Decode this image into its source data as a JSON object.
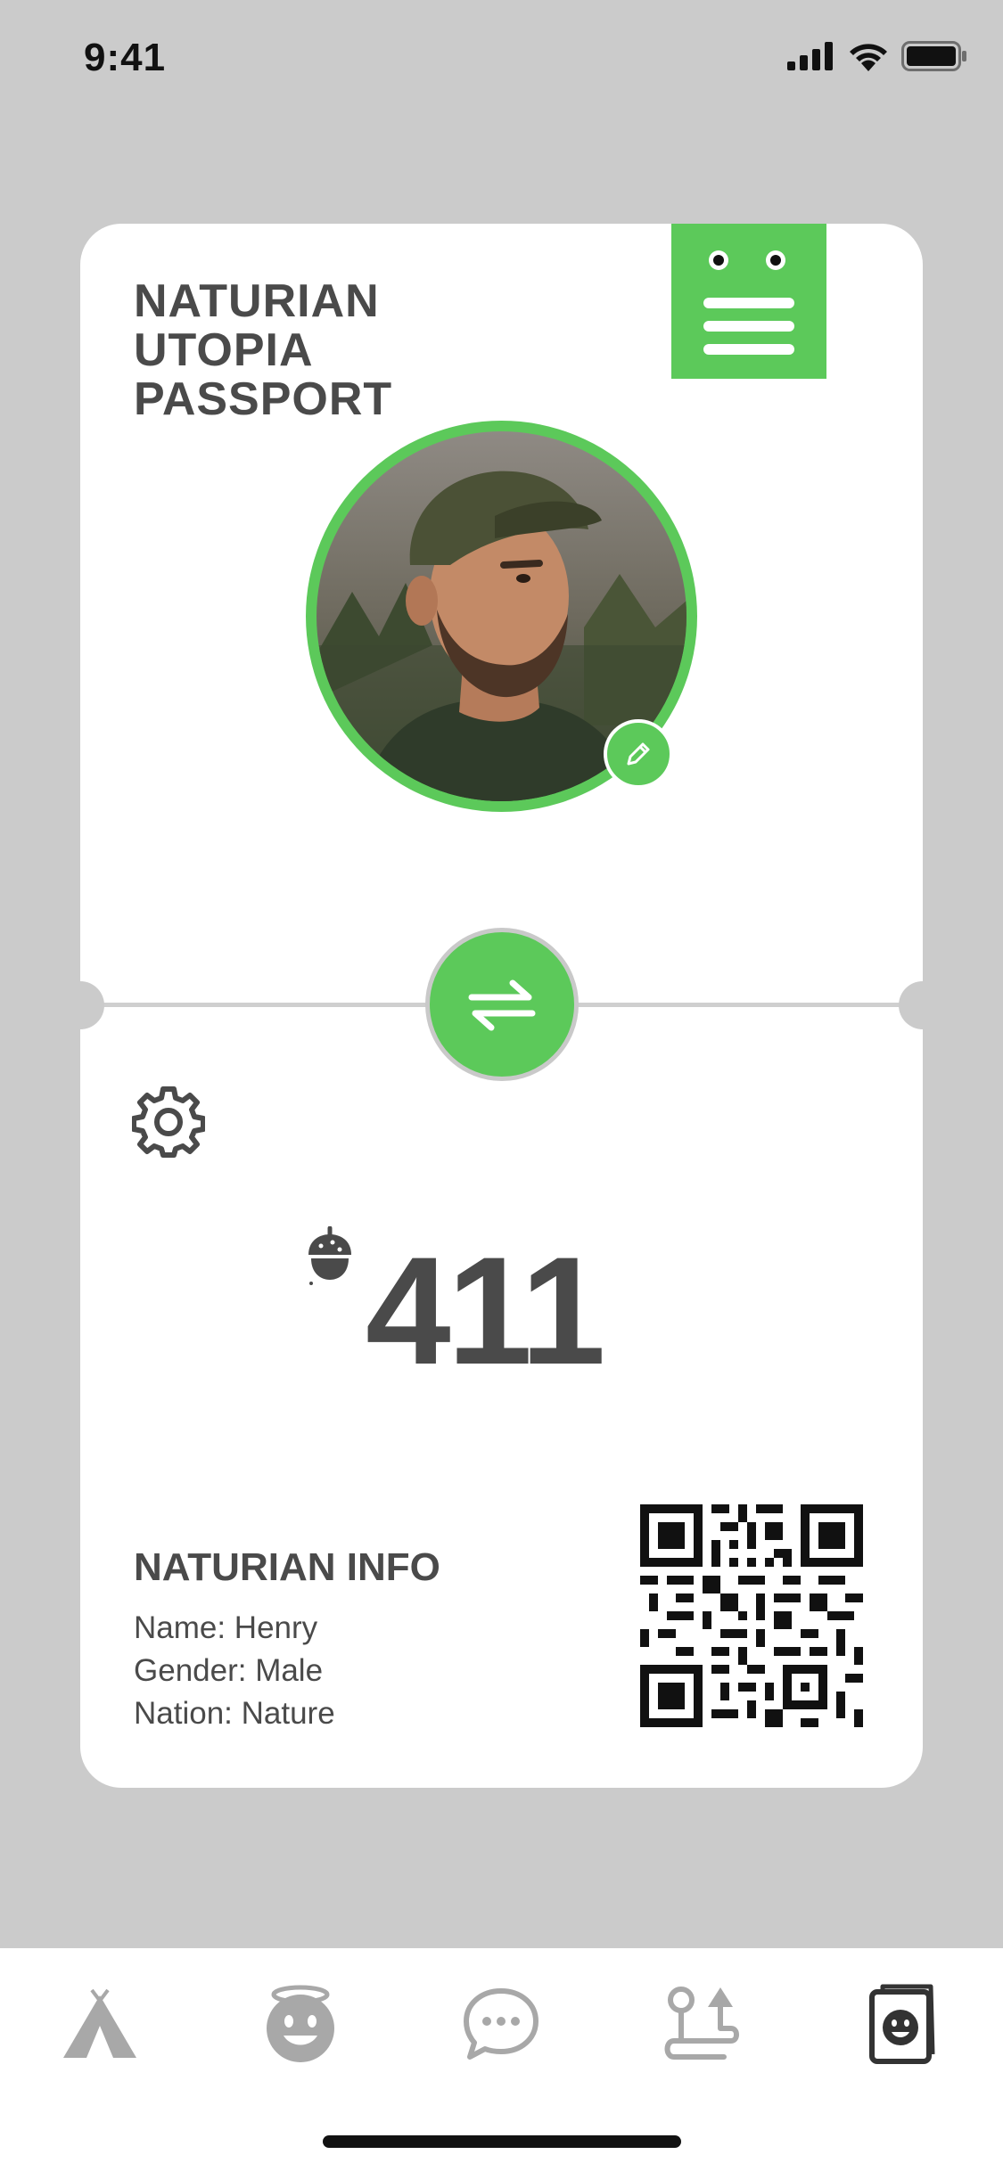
{
  "status_bar": {
    "time": "9:41",
    "icons": [
      "cellular-signal-icon",
      "wifi-icon",
      "battery-icon"
    ]
  },
  "card": {
    "title_lines": [
      "NATURIAN",
      "UTOPIA",
      "PASSPORT"
    ],
    "menu_icon": "mascot-menu-icon",
    "avatar": "profile-photo",
    "edit_icon": "pencil-icon",
    "swap_icon": "swap-arrows-icon",
    "settings_icon": "gear-icon",
    "currency_icon": "acorn-icon",
    "balance": "411",
    "info": {
      "heading": "NATURIAN INFO",
      "name": "Name: Henry",
      "gender": "Gender: Male",
      "nation": "Nation: Nature"
    },
    "qr_icon": "qr-code"
  },
  "tab_bar": {
    "tabs": [
      {
        "icon": "tent-icon",
        "active": false
      },
      {
        "icon": "angel-face-icon",
        "active": false
      },
      {
        "icon": "chat-bubble-icon",
        "active": false
      },
      {
        "icon": "route-icon",
        "active": false
      },
      {
        "icon": "passport-icon",
        "active": true
      }
    ]
  },
  "colors": {
    "background": "#cbcbcb",
    "card": "#ffffff",
    "accent_green": "#5cc95a",
    "text_dark": "#4a4a4a",
    "tab_icon_inactive": "#a8a8a8",
    "tab_icon_active": "#333333"
  }
}
